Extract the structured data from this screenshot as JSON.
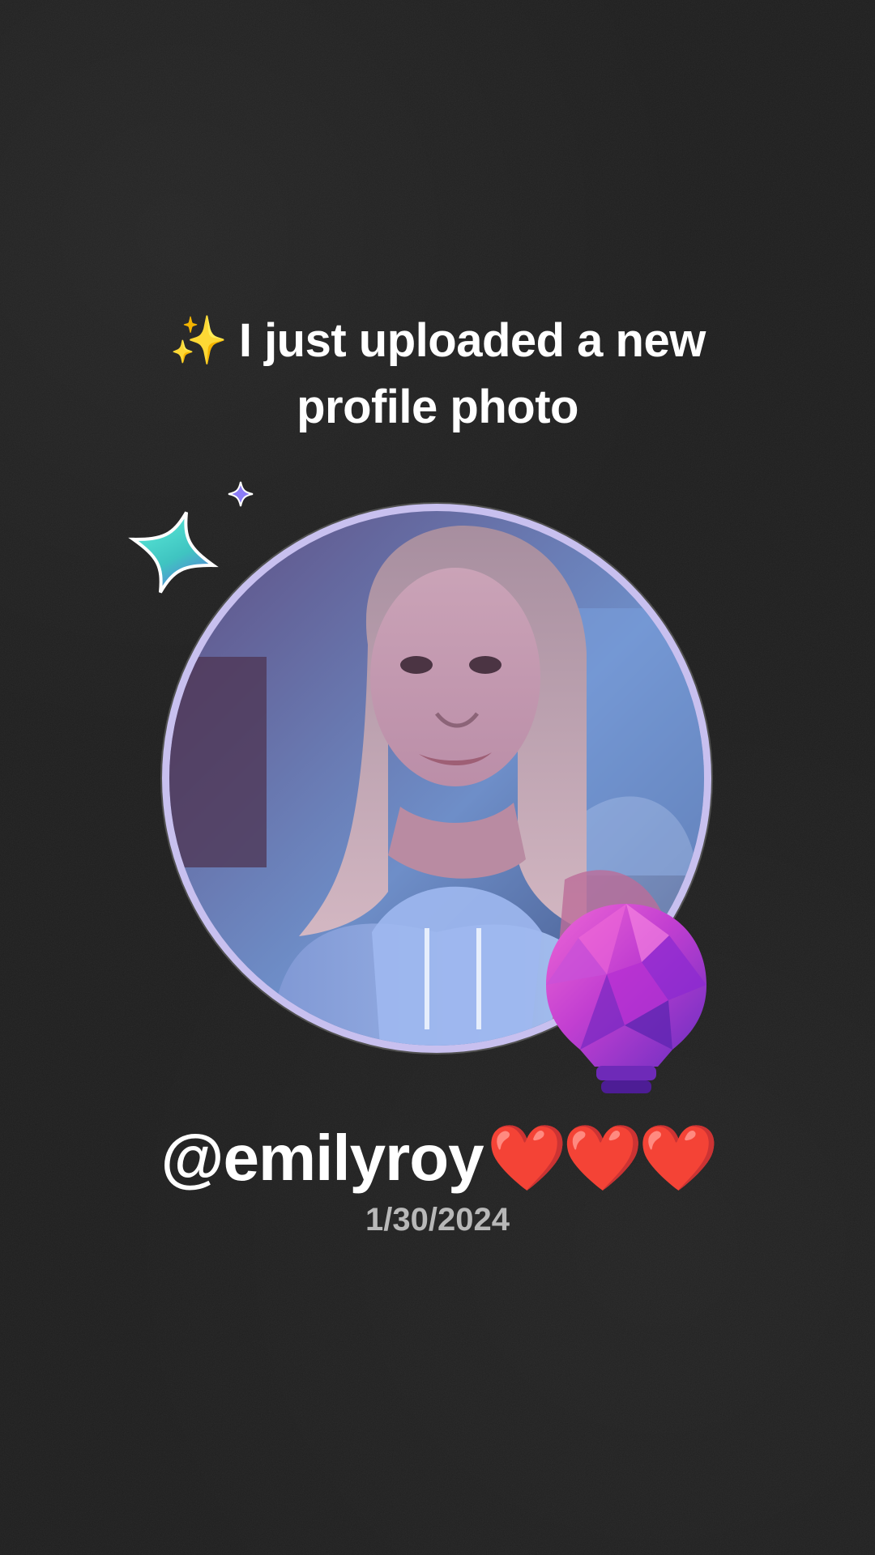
{
  "headline": {
    "emoji": "✨",
    "line1": "I just uploaded a new",
    "line2": "profile photo"
  },
  "profile": {
    "username": "@emilyroy",
    "hearts": "❤️❤️❤️",
    "date": "1/30/2024"
  },
  "icons": {
    "sparkle_emoji": "sparkles-icon",
    "teal_star": "four-point-star-icon",
    "pink_star": "four-point-star-icon",
    "small_star": "four-point-star-icon",
    "bulb": "lightbulb-icon"
  },
  "colors": {
    "background": "#1f1f1f",
    "text": "#ffffff",
    "date": "#b8b8b8",
    "ring": "#c8c0ef",
    "heart": "#e01e25",
    "teal_star": "#49d7c4",
    "pink_star": "#ef4fd5",
    "violet": "#8b5cf6"
  }
}
